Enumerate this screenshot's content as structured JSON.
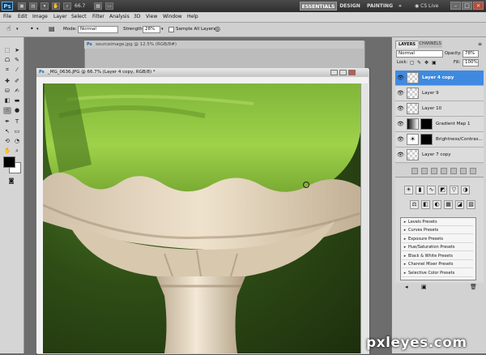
{
  "app": {
    "logo": "Ps",
    "zoom": "66.7",
    "more_icon": "»",
    "cs_live": "CS Live"
  },
  "workspaces": {
    "essentials": "ESSENTIALS",
    "design": "DESIGN",
    "painting": "PAINTING"
  },
  "menu": [
    "File",
    "Edit",
    "Image",
    "Layer",
    "Select",
    "Filter",
    "Analysis",
    "3D",
    "View",
    "Window",
    "Help"
  ],
  "options": {
    "mode_label": "Mode:",
    "mode_value": "Normal",
    "strength_label": "Strength:",
    "strength_value": "28%",
    "sample_all_label": "Sample All Layers"
  },
  "documents": {
    "background_title": "sourceimage.jpg @ 12.5% (RGB/8#)",
    "active_title": "_MG_0636.JPG @ 66.7% (Layer 4 copy, RGB/8) *"
  },
  "layers_panel": {
    "tab_layers": "LAYERS",
    "tab_channels": "CHANNELS",
    "blend_mode": "Normal",
    "opacity_label": "Opacity:",
    "opacity_value": "78%",
    "lock_label": "Lock:",
    "fill_label": "Fill:",
    "fill_value": "100%",
    "layers": [
      {
        "name": "Layer 4 copy",
        "selected": true
      },
      {
        "name": "Layer 9",
        "selected": false
      },
      {
        "name": "Layer 10",
        "selected": false
      },
      {
        "name": "Gradient Map 1",
        "selected": false
      },
      {
        "name": "Brightness/Contras...",
        "selected": false
      },
      {
        "name": "Layer 7 copy",
        "selected": false
      }
    ]
  },
  "adjustments": {
    "presets": [
      "Levels Presets",
      "Curves Presets",
      "Exposure Presets",
      "Hue/Saturation Presets",
      "Black & White Presets",
      "Channel Mixer Presets",
      "Selective Color Presets"
    ]
  },
  "watermark": "pxleyes.com",
  "colors": {
    "accent": "#3f8ae0",
    "foreground": "#000000",
    "background": "#ffffff"
  }
}
